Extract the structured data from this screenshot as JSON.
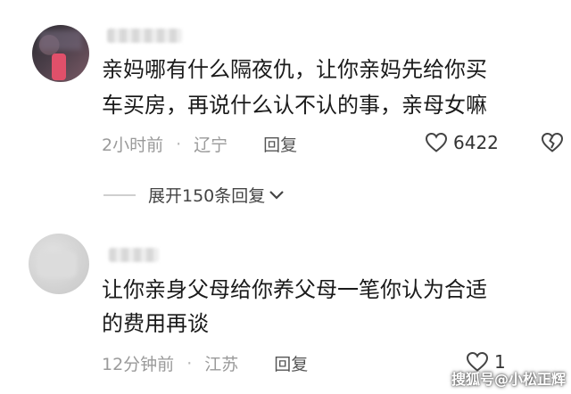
{
  "comments": [
    {
      "text_lines": [
        "亲妈哪有什么隔夜仇，让你亲妈先给你买",
        "车买房，再说什么认不认的事，亲母女嘛"
      ],
      "time": "2小时前",
      "location": "辽宁",
      "reply_label": "回复",
      "likes": "6422",
      "expand_label": "展开150条回复"
    },
    {
      "text_lines": [
        "让你亲身父母给你养父母一笔你认为合适",
        "的费用再谈"
      ],
      "time": "12分钟前",
      "location": "江苏",
      "reply_label": "回复",
      "likes": "1"
    }
  ],
  "separator": "·",
  "watermark": "搜狐号@小松正辉",
  "icons": {
    "like": "heart-outline-icon",
    "dislike": "broken-heart-icon",
    "expand": "chevron-down-icon"
  },
  "colors": {
    "text": "#1a1a1a",
    "meta": "#9a9a9a",
    "reply": "#555555"
  }
}
